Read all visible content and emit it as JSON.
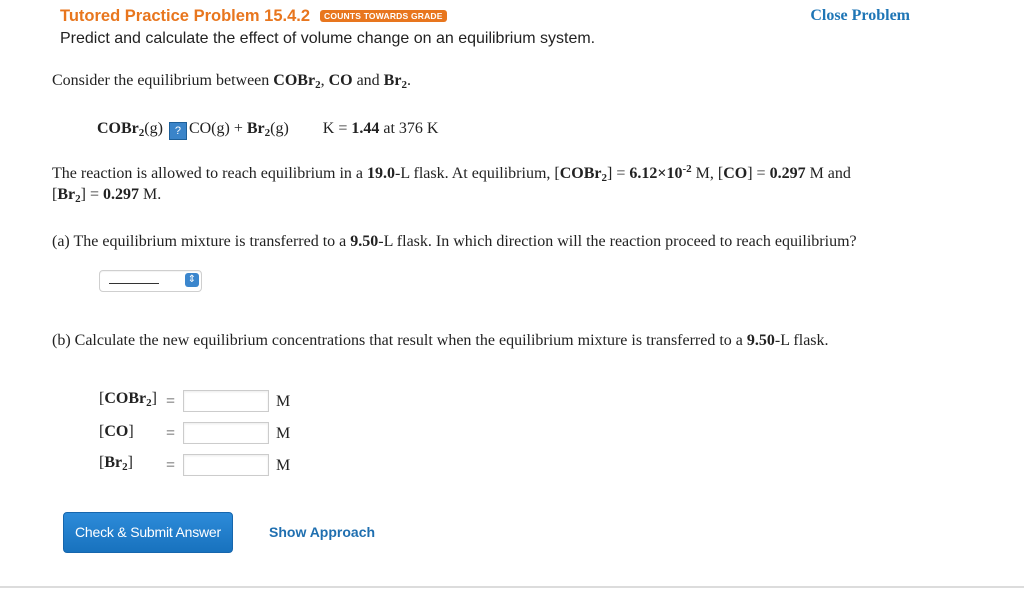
{
  "header": {
    "title": "Tutored Practice Problem 15.4.2",
    "badge": "COUNTS TOWARDS GRADE",
    "subtitle": "Predict and calculate the effect of volume change on an equilibrium system.",
    "close_label": "Close Problem"
  },
  "intro": {
    "text": "Consider the equilibrium between ",
    "species1": "COBr",
    "species1_sub": "2",
    "sep1": ", ",
    "species2": "CO",
    "sep2": " and ",
    "species3": "Br",
    "species3_sub": "2",
    "end": "."
  },
  "reaction": {
    "reactant": "COBr",
    "reactant_sub": "2",
    "reactant_state": "(g)",
    "arrow_icon": "question-mark-icon",
    "arrow_symbol": "?",
    "product1": "CO(g) + ",
    "product2": "Br",
    "product2_sub": "2",
    "product2_state": "(g)",
    "k_label": "K = ",
    "k_value": "1.44",
    "k_temp_pre": " at ",
    "k_temp": "376 K"
  },
  "setup": {
    "t1": "The reaction is allowed to reach equilibrium in a ",
    "volume": "19.0",
    "t2": "-L flask. At equilibrium, [",
    "cobr": "COBr",
    "cobr_sub": "2",
    "t3": "] = ",
    "cobr_val": "6.12×10",
    "cobr_exp": "-2",
    "t4": " M, [",
    "co": "CO",
    "t5": "] = ",
    "co_val": "0.297",
    "t6": " M and",
    "t7": "[",
    "br": "Br",
    "br_sub": "2",
    "t8": "] = ",
    "br_val": "0.297",
    "t9": " M."
  },
  "part_a": {
    "t1": "(a) The equilibrium mixture is transferred to a ",
    "volume": "9.50",
    "t2": "-L flask. In which direction will the reaction proceed to reach equilibrium?",
    "select_value": "_______",
    "select_arrow_icon": "select-updown-icon"
  },
  "part_b": {
    "t1": "(b) Calculate the new equilibrium concentrations that result when the equilibrium mixture is transferred to a ",
    "volume": "9.50",
    "t2": "-L flask.",
    "rows": [
      {
        "open": "[",
        "name": "COBr",
        "sub": "2",
        "close": "]",
        "eq": "=",
        "value": "",
        "unit": "M"
      },
      {
        "open": "[",
        "name": "CO",
        "sub": "",
        "close": "]",
        "eq": "=",
        "value": "",
        "unit": "M"
      },
      {
        "open": "[",
        "name": "Br",
        "sub": "2",
        "close": "]",
        "eq": "=",
        "value": "",
        "unit": "M"
      }
    ]
  },
  "actions": {
    "submit_label": "Check & Submit Answer",
    "approach_label": "Show Approach"
  },
  "colors": {
    "accent_orange": "#e8761e",
    "link_blue": "#1f76b6",
    "button_blue": "#1872be"
  }
}
